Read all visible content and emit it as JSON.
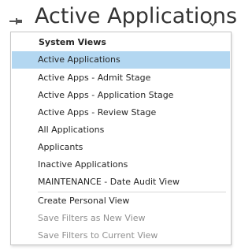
{
  "header": {
    "title": "Active Applications",
    "pin_icon": "pin-icon",
    "dropdown_icon": "chevron-down-icon"
  },
  "menu": {
    "section_title": "System Views",
    "views": [
      {
        "label": "Active Applications",
        "selected": true
      },
      {
        "label": "Active Apps - Admit Stage"
      },
      {
        "label": "Active Apps - Application Stage"
      },
      {
        "label": "Active Apps - Review Stage"
      },
      {
        "label": "All Applications"
      },
      {
        "label": "Applicants"
      },
      {
        "label": "Inactive Applications"
      },
      {
        "label": "MAINTENANCE - Date Audit View"
      }
    ],
    "actions": [
      {
        "label": "Create Personal View",
        "enabled": true
      },
      {
        "label": "Save Filters as New View",
        "enabled": false
      },
      {
        "label": "Save Filters to Current View",
        "enabled": false
      }
    ]
  },
  "colors": {
    "selected_background": "#b3d7f1",
    "disabled_text": "#8f8f8f"
  }
}
